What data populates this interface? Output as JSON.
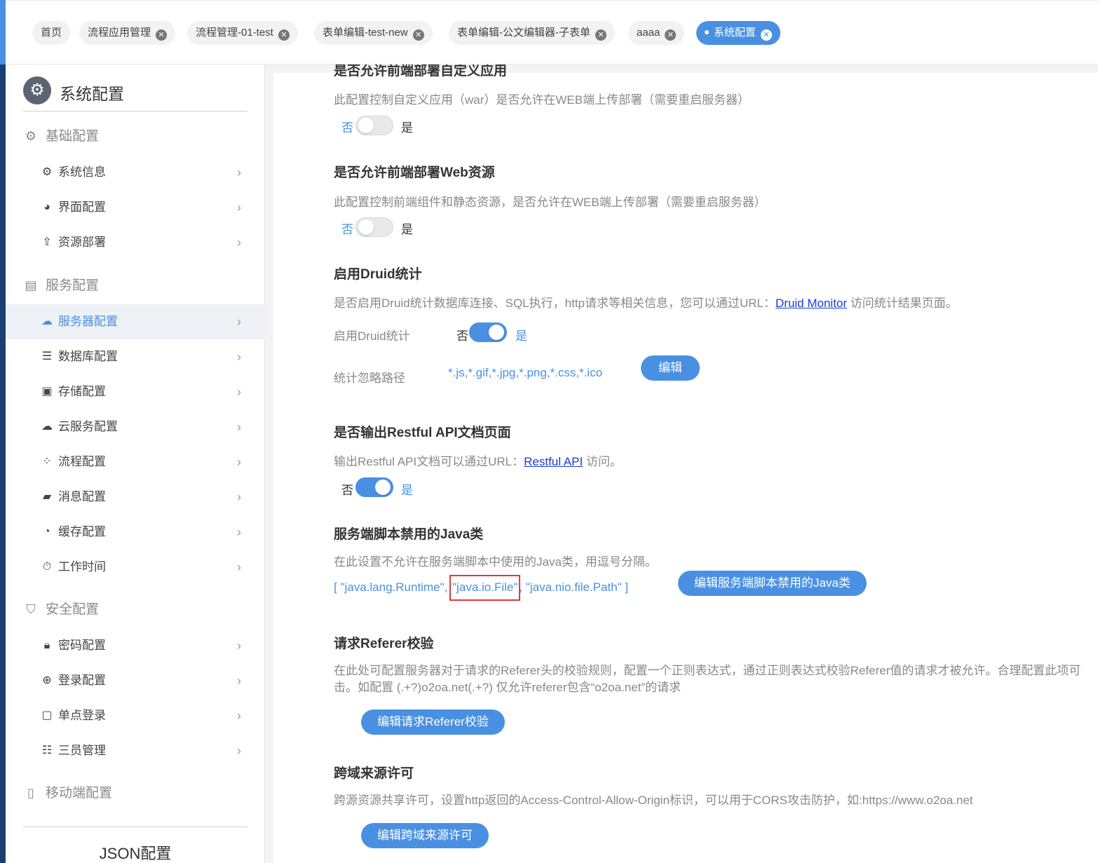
{
  "tabs": [
    {
      "label": "首页",
      "closable": false
    },
    {
      "label": "流程应用管理",
      "closable": true
    },
    {
      "label": "流程管理-01-test",
      "closable": true
    },
    {
      "label": "表单编辑-test-new",
      "closable": true
    },
    {
      "label": "表单编辑-公文编辑器-子表单",
      "closable": true
    },
    {
      "label": "aaaa",
      "closable": true
    },
    {
      "label": "系统配置",
      "closable": true,
      "active": true
    }
  ],
  "sidebar": {
    "title": "系统配置",
    "groups": [
      {
        "label": "基础配置",
        "icon": "gear-icon"
      },
      {
        "label": "服务配置",
        "icon": "server-icon"
      },
      {
        "label": "安全配置",
        "icon": "shield-icon"
      },
      {
        "label": "移动端配置",
        "icon": "mobile-icon"
      }
    ],
    "items": [
      {
        "label": "系统信息",
        "icon": "gear-icon"
      },
      {
        "label": "界面配置",
        "icon": "palette-icon"
      },
      {
        "label": "资源部署",
        "icon": "upload-icon"
      },
      {
        "label": "服务器配置",
        "icon": "server-config-icon",
        "active": true
      },
      {
        "label": "数据库配置",
        "icon": "database-icon"
      },
      {
        "label": "存储配置",
        "icon": "archive-icon"
      },
      {
        "label": "云服务配置",
        "icon": "cloud-icon"
      },
      {
        "label": "流程配置",
        "icon": "flow-icon"
      },
      {
        "label": "消息配置",
        "icon": "message-icon"
      },
      {
        "label": "缓存配置",
        "icon": "pie-icon"
      },
      {
        "label": "工作时间",
        "icon": "stopwatch-icon"
      },
      {
        "label": "密码配置",
        "icon": "lock-icon"
      },
      {
        "label": "登录配置",
        "icon": "login-icon"
      },
      {
        "label": "单点登录",
        "icon": "sso-icon"
      },
      {
        "label": "三员管理",
        "icon": "list-icon"
      }
    ],
    "json_config": "JSON配置"
  },
  "main": {
    "war": {
      "title_partial": "是否允许前端部署自定义应用",
      "desc": "此配置控制自定义应用（war）是否允许在WEB端上传部署（需要重启服务器）",
      "off_label": "否",
      "on_label": "是",
      "enabled": false
    },
    "web": {
      "title": "是否允许前端部署Web资源",
      "desc": "此配置控制前端组件和静态资源，是否允许在WEB端上传部署（需要重启服务器）",
      "off_label": "否",
      "on_label": "是",
      "enabled": false
    },
    "druid": {
      "title": "启用Druid统计",
      "desc_before": "是否启用Druid统计数据库连接、SQL执行，http请求等相关信息，您可以通过URL：",
      "link": "Druid Monitor",
      "desc_after": " 访问统计结果页面。",
      "switch_label": "启用Druid统计",
      "off_label": "否",
      "on_label": "是",
      "enabled": true,
      "ignore_label": "统计忽略路径",
      "ignore_value": "*.js,*.gif,*.jpg,*.png,*.css,*.ico",
      "edit_button": "编辑"
    },
    "restful": {
      "title": "是否输出Restful API文档页面",
      "desc_before": "输出Restful API文档可以通过URL：",
      "link": "Restful API",
      "desc_after": " 访问。",
      "off_label": "否",
      "on_label": "是",
      "enabled": true
    },
    "java": {
      "title": "服务端脚本禁用的Java类",
      "desc": "在此设置不允许在服务端脚本中使用的Java类，用逗号分隔。",
      "open": "[ ",
      "item1": "\"java.lang.Runtime\"",
      "sep1": ", ",
      "item2": "\"java.io.File\"",
      "sep2": ", ",
      "item3": "\"java.nio.file.Path\"",
      "close": " ]",
      "edit_button": "编辑服务端脚本禁用的Java类"
    },
    "referer": {
      "title": "请求Referer校验",
      "desc_line1": "在此处可配置服务器对于请求的Referer头的校验规则，配置一个正则表达式，通过正则表达式校验Referer值的请求才被允许。合理配置此项可",
      "desc_line2": "击。如配置 (.+?)o2oa.net(.+?) 仅允许referer包含“o2oa.net”的请求",
      "edit_button": "编辑请求Referer校验"
    },
    "cors": {
      "title": "跨域来源许可",
      "desc": "跨源资源共享许可，设置http返回的Access-Control-Allow-Origin标识，可以用于CORS攻击防护，如:https://www.o2oa.net",
      "edit_button": "编辑跨域来源许可"
    }
  }
}
